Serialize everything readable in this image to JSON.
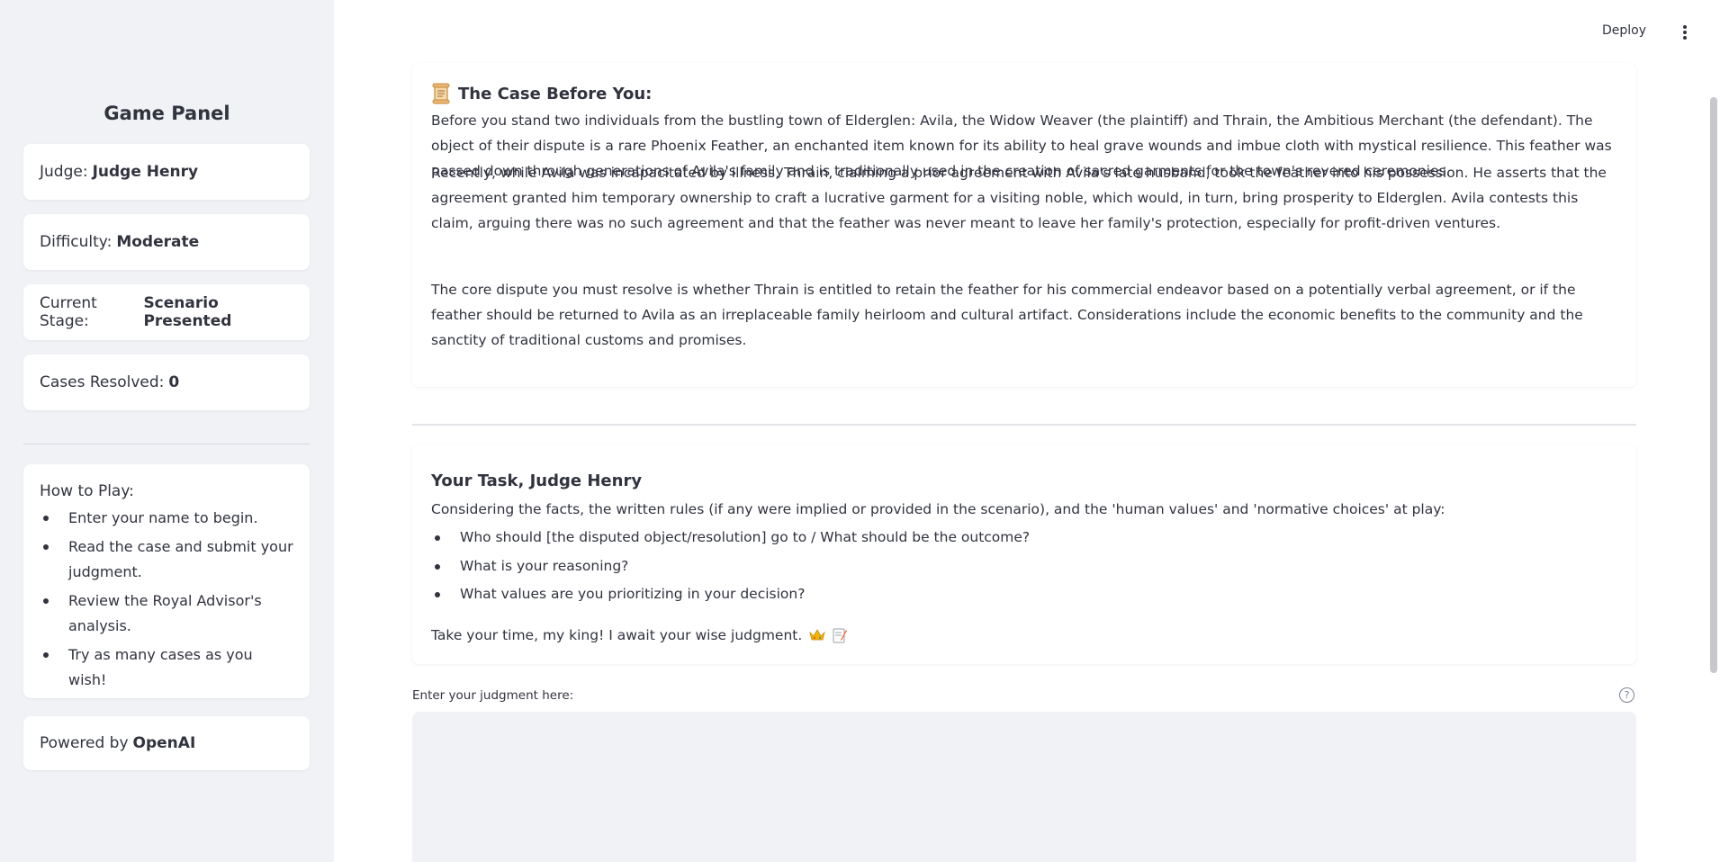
{
  "sidebar": {
    "title": "Game Panel",
    "judge": {
      "label": "Judge:",
      "value": "Judge Henry"
    },
    "difficulty": {
      "label": "Difficulty:",
      "value": "Moderate"
    },
    "stage": {
      "label": "Current Stage:",
      "value": "Scenario Presented"
    },
    "cases": {
      "label": "Cases Resolved:",
      "value": "0"
    },
    "how_to_play": {
      "title": "How to Play:",
      "items": [
        "Enter your name to begin.",
        "Read the case and submit your judgment.",
        "Review the Royal Advisor's analysis.",
        "Try as many cases as you wish!"
      ]
    },
    "powered": {
      "label": "Powered by",
      "value": "OpenAI"
    }
  },
  "header": {
    "deploy_label": "Deploy",
    "menu_icon": "vertical-dots-icon"
  },
  "case": {
    "icon": "scroll-icon",
    "heading": "The Case Before You:",
    "paragraph1": "Before you stand two individuals from the bustling town of Elderglen: Avila, the Widow Weaver (the plaintiff) and Thrain, the Ambitious Merchant (the defendant). The object of their dispute is a rare Phoenix Feather, an enchanted item known for its ability to heal grave wounds and imbue cloth with mystical resilience. This feather was passed down through generations of Avila's family and is traditionally used in the creation of sacred garments for the town's revered ceremonies.",
    "paragraph2": "Recently, while Avila was incapacitated by illness, Thrain, claiming a prior agreement with Avila's late husband, took the feather into his possession. He asserts that the agreement granted him temporary ownership to craft a lucrative garment for a visiting noble, which would, in turn, bring prosperity to Elderglen. Avila contests this claim, arguing there was no such agreement and that the feather was never meant to leave her family's protection, especially for profit-driven ventures.",
    "paragraph3": "The core dispute you must resolve is whether Thrain is entitled to retain the feather for his commercial endeavor based on a potentially verbal agreement, or if the feather should be returned to Avila as an irreplaceable family heirloom and cultural artifact. Considerations include the economic benefits to the community and the sanctity of traditional customs and promises."
  },
  "task": {
    "heading": "Your Task, Judge Henry",
    "intro": "Considering the facts, the written rules (if any were implied or provided in the scenario), and the 'human values' and 'normative choices' at play:",
    "questions": [
      "Who should [the disputed object/resolution] go to / What should be the outcome?",
      "What is your reasoning?",
      "What values are you prioritizing in your decision?"
    ],
    "closing": "Take your time, my king! I await your wise judgment.",
    "closing_icons": [
      "crown-icon",
      "memo-icon"
    ]
  },
  "judgment": {
    "label": "Enter your judgment here:",
    "value": "",
    "help_icon": "help-circle-icon"
  }
}
